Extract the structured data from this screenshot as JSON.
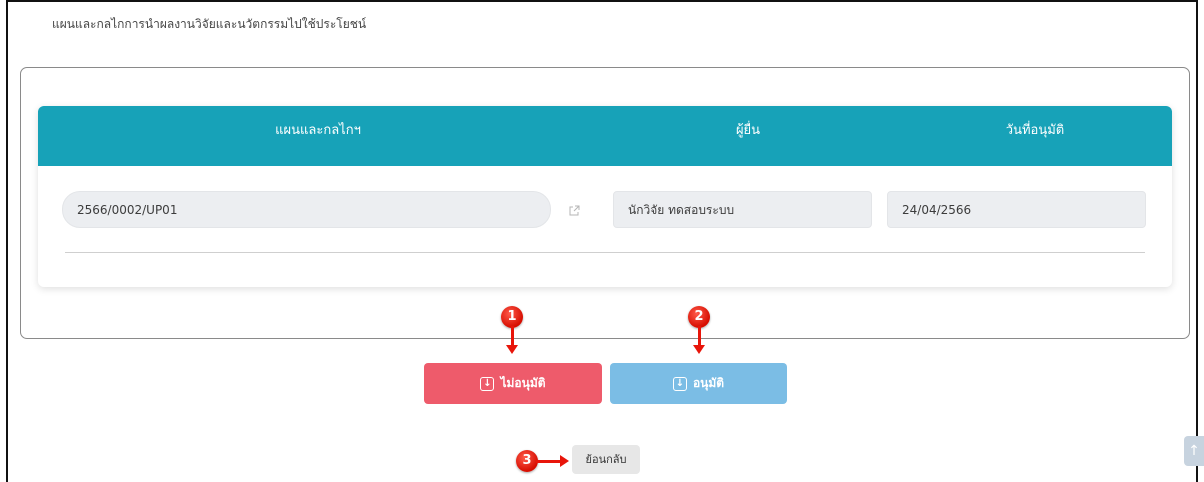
{
  "section_title": "แผนและกลไกการนำผลงานวิจัยและนวัตกรรมไปใช้ประโยชน์",
  "table": {
    "headers": {
      "plan": "แผนและกลไกฯ",
      "submitter": "ผู้ยื่น",
      "approval_date": "วันที่อนุมัติ"
    },
    "row": {
      "plan": "2566/0002/UP01",
      "submitter": "นักวิจัย  ทดสอบระบบ",
      "approval_date": "24/04/2566"
    }
  },
  "buttons": {
    "reject": "ไม่อนุมัติ",
    "approve": "อนุมัติ",
    "back": "ย้อนกลับ"
  },
  "markers": [
    "1",
    "2",
    "3"
  ],
  "icons": {
    "external_link": "external-link-icon",
    "download": "download-icon",
    "scroll_top": "arrow-up-icon"
  },
  "colors": {
    "header": "#17a2b8",
    "reject": "#ee5b6b",
    "approve": "#7bbde5",
    "marker": "#e8150a"
  }
}
